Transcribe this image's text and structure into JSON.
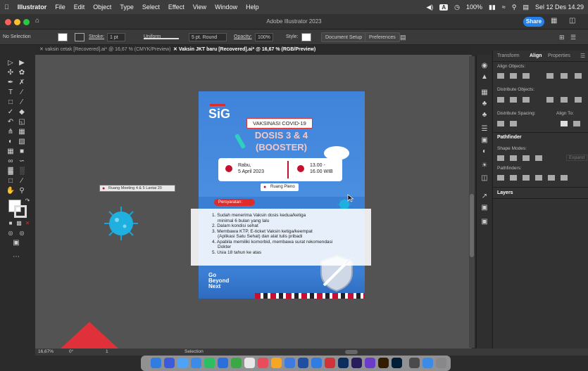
{
  "menubar": {
    "app": "Illustrator",
    "items": [
      "File",
      "Edit",
      "Object",
      "Type",
      "Select",
      "Effect",
      "View",
      "Window",
      "Help"
    ],
    "status_a": "A",
    "battery": "100%",
    "date": "Sel 12 Des 14.29"
  },
  "titlebar": {
    "title": "Adobe Illustrator 2023",
    "share": "Share"
  },
  "controlbar": {
    "selection": "No Selection",
    "stroke_label": "Stroke:",
    "stroke_value": "1 pt",
    "uniform": "Uniform",
    "brush": "5 pt. Round",
    "opacity_label": "Opacity:",
    "opacity_value": "100%",
    "style_label": "Style:",
    "document_setup": "Document Setup",
    "preferences": "Preferences"
  },
  "tabs": [
    {
      "label": "vaksin cetak [Recovered].ai* @ 16,67 % (CMYK/Preview)"
    },
    {
      "label": "Vaksin JKT baru [Recovered].ai* @ 16,67 % (RGB/Preview)"
    }
  ],
  "canvas": {
    "location_tag": "Ruang Meeting 4 & 5 Lantai 20"
  },
  "poster": {
    "logo": "SiG",
    "headline": "VAKSINASI COVID-19",
    "dose": "DOSIS 3 & 4",
    "booster": "(BOOSTER)",
    "day": "Rabu,",
    "date": "5 April 2023",
    "time_start": "13.00 -",
    "time_end": "16.00 WIB",
    "venue": "Ruang Pleno",
    "req_title": "Persyaratan:",
    "requirements": [
      "1. Sudah menerima Vaksin dosis kedua/ketiga",
      "minimal 6 bulan yang lalu",
      "2. Dalam kondisi sehat",
      "3. Membawa KTP, E-ticket Vaksin ketiga/keempat",
      "(Aplikasi Satu Sehat) dan alat tulis pribadi",
      "4. Apabila memiliki komorbid, membawa surat rekomendasi",
      "Dokter",
      "5. Usia 18 tahun ke atas"
    ],
    "tagline_1": "Go",
    "tagline_2": "Beyond",
    "tagline_3": "Next"
  },
  "panel": {
    "tabs": [
      "Transform",
      "Align",
      "Properties"
    ],
    "align_objects": "Align Objects:",
    "distribute_objects": "Distribute Objects:",
    "distribute_spacing": "Distribute Spacing:",
    "align_to": "Align To:",
    "pathfinder": "Pathfinder",
    "shape_modes": "Shape Modes:",
    "expand": "Expand",
    "pathfinders": "Pathfinders:",
    "layers": "Layers"
  },
  "statusbar": {
    "zoom": "16,67%",
    "rotate": "0°",
    "page": "1",
    "mode": "Selection"
  }
}
